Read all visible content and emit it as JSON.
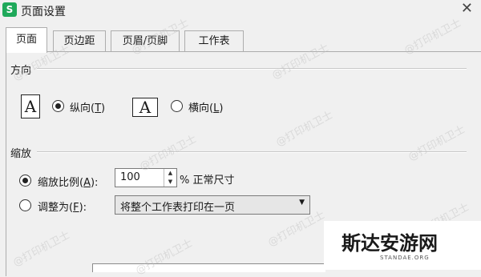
{
  "window": {
    "app_icon_letter": "S",
    "title": "页面设置",
    "close_symbol": "✕"
  },
  "tabs": [
    {
      "label": "页面"
    },
    {
      "label": "页边距"
    },
    {
      "label": "页眉/页脚"
    },
    {
      "label": "工作表"
    }
  ],
  "orientation": {
    "group_label": "方向",
    "paper_glyph": "A",
    "portrait": {
      "label_main": "纵向(",
      "mnemonic": "T",
      "label_tail": ")",
      "selected": true
    },
    "landscape": {
      "label_main": "横向(",
      "mnemonic": "L",
      "label_tail": ")",
      "selected": false
    }
  },
  "scaling": {
    "group_label": "缩放",
    "scale_option": {
      "label_main": "缩放比例(",
      "mnemonic": "A",
      "label_tail": "):",
      "selected": true
    },
    "scale_value": "100",
    "scale_suffix": "% 正常尺寸",
    "fit_option": {
      "label_main": "调整为(",
      "mnemonic": "F",
      "label_tail": "):",
      "selected": false
    },
    "fit_value": "将整个工作表打印在一页"
  },
  "watermark": {
    "text": "@打印机卫士"
  },
  "overlay_logo": {
    "title": "斯达安游网",
    "subtitle": "STANDAE.ORG"
  }
}
